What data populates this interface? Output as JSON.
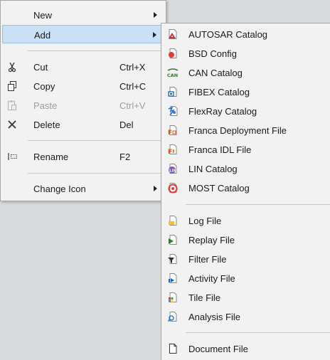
{
  "main_menu": {
    "new_label": "New",
    "add_label": "Add",
    "cut_label": "Cut",
    "cut_shortcut": "Ctrl+X",
    "copy_label": "Copy",
    "copy_shortcut": "Ctrl+C",
    "paste_label": "Paste",
    "paste_shortcut": "Ctrl+V",
    "delete_label": "Delete",
    "delete_shortcut": "Del",
    "rename_label": "Rename",
    "rename_shortcut": "F2",
    "change_icon_label": "Change Icon"
  },
  "add_submenu": {
    "items": [
      {
        "label": "AUTOSAR Catalog",
        "icon": "autosar-catalog-icon"
      },
      {
        "label": "BSD Config",
        "icon": "bsd-config-icon"
      },
      {
        "label": "CAN Catalog",
        "icon": "can-catalog-icon"
      },
      {
        "label": "FIBEX Catalog",
        "icon": "fibex-catalog-icon"
      },
      {
        "label": "FlexRay Catalog",
        "icon": "flexray-catalog-icon"
      },
      {
        "label": "Franca Deployment File",
        "icon": "franca-deployment-icon"
      },
      {
        "label": "Franca IDL File",
        "icon": "franca-idl-icon"
      },
      {
        "label": "LIN Catalog",
        "icon": "lin-catalog-icon"
      },
      {
        "label": "MOST Catalog",
        "icon": "most-catalog-icon"
      },
      {
        "label": "Log File",
        "icon": "log-file-icon"
      },
      {
        "label": "Replay File",
        "icon": "replay-file-icon"
      },
      {
        "label": "Filter File",
        "icon": "filter-file-icon"
      },
      {
        "label": "Activity File",
        "icon": "activity-file-icon"
      },
      {
        "label": "Tile File",
        "icon": "tile-file-icon"
      },
      {
        "label": "Analysis File",
        "icon": "analysis-file-icon"
      },
      {
        "label": "Document File",
        "icon": "document-file-icon"
      }
    ]
  },
  "colors": {
    "highlight": "#c9e0f7",
    "highlight_border": "#99c2ea",
    "menu_bg": "#f2f2f2",
    "disabled_text": "#9c9c9c"
  }
}
